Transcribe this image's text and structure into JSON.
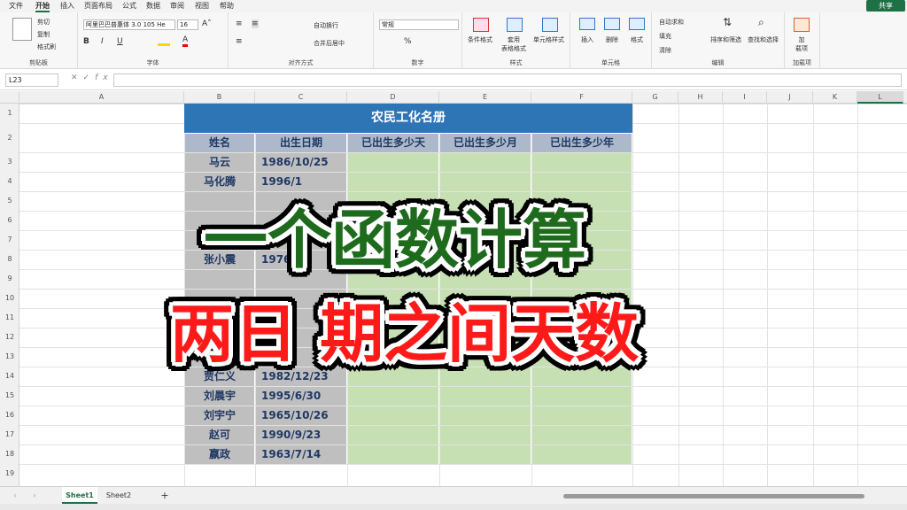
{
  "menu": {
    "items": [
      "文件",
      "开始",
      "插入",
      "页面布局",
      "公式",
      "数据",
      "审阅",
      "视图",
      "帮助"
    ],
    "active_index": 1,
    "share_label": "共享"
  },
  "ribbon": {
    "clipboard": {
      "cut": "剪切",
      "copy": "复制",
      "format_painter": "格式刷",
      "label": "剪贴板"
    },
    "font": {
      "name": "阿里巴巴普惠体 3.0 105 He",
      "size": "16",
      "label": "字体"
    },
    "alignment": {
      "wrap": "自动换行",
      "merge": "合并后居中",
      "label": "对齐方式"
    },
    "number": {
      "format": "常规",
      "label": "数字"
    },
    "styles": {
      "conditional": "条件格式",
      "table": "套用\n表格格式",
      "cell": "单元格样式",
      "label": "样式"
    },
    "cells": {
      "insert": "插入",
      "delete": "删除",
      "format": "格式",
      "label": "单元格"
    },
    "editing": {
      "autosum": "自动求和",
      "fill": "填充",
      "clear": "清除",
      "sort": "排序和筛选",
      "find": "查找和选择",
      "label": "编辑"
    },
    "addins": {
      "label_btn": "加\n载项",
      "label": "加载项"
    }
  },
  "formula_bar": {
    "name_box": "L23",
    "formula": ""
  },
  "columns": [
    "A",
    "B",
    "C",
    "D",
    "E",
    "F",
    "G",
    "H",
    "I",
    "J",
    "K",
    "L"
  ],
  "rows": [
    "1",
    "2",
    "3",
    "4",
    "5",
    "6",
    "7",
    "8",
    "9",
    "10",
    "11",
    "12",
    "13",
    "14",
    "15",
    "16",
    "17",
    "18",
    "19"
  ],
  "sheet": {
    "title": "农民工化名册",
    "headers": [
      "姓名",
      "出生日期",
      "已出生多少天",
      "已出生多少月",
      "已出生多少年"
    ],
    "records": [
      {
        "name": "马云",
        "date": "1986/10/25"
      },
      {
        "name": "马化腾",
        "date": "1996/1"
      },
      {
        "name": "",
        "date": ""
      },
      {
        "name": "",
        "date": ""
      },
      {
        "name": "",
        "date": ""
      },
      {
        "name": "张小震",
        "date": "1976/1"
      },
      {
        "name": "",
        "date": ""
      },
      {
        "name": "",
        "date": ""
      },
      {
        "name": "",
        "date": ""
      },
      {
        "name": "",
        "date": ""
      },
      {
        "name": "",
        "date": ""
      },
      {
        "name": "贾仁义",
        "date": "1982/12/23"
      },
      {
        "name": "刘晨宇",
        "date": "1995/6/30"
      },
      {
        "name": "刘宇宁",
        "date": "1965/10/26"
      },
      {
        "name": "赵可",
        "date": "1990/9/23"
      },
      {
        "name": "嬴政",
        "date": "1963/7/14"
      }
    ]
  },
  "overlay": {
    "line1": "一个函数计算",
    "line2": "两日 期之间天数"
  },
  "tabs": {
    "sheets": [
      "Sheet1",
      "Sheet2"
    ],
    "add": "+"
  },
  "colors": {
    "accent": "#1e7145",
    "title_bg": "#2e75b6",
    "header_bg": "#adb9ca",
    "name_bg": "#bfbfbf",
    "result_bg": "#c6e0b4",
    "overlay_green": "#1e6b1e",
    "overlay_red": "#ff1a1a"
  }
}
